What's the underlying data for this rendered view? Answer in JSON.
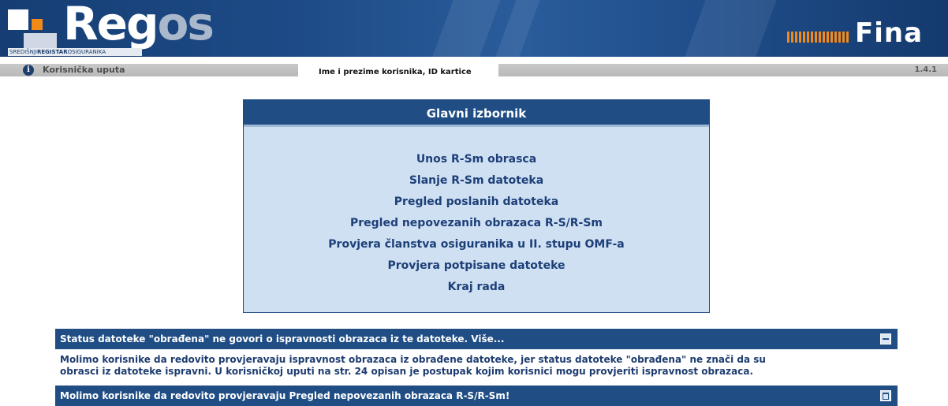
{
  "header": {
    "logo_main": "Reg",
    "logo_os": "os",
    "logo_sub_pre": "SREDIŠNJI",
    "logo_sub_bold": "REGISTAR",
    "logo_sub_post": "OSIGURANIKA",
    "fina_logo": "Fina"
  },
  "infobar": {
    "manual_link": "Korisnička uputa",
    "user": "Ime i prezime korisnika, ID kartice",
    "version": "1.4.1"
  },
  "menu": {
    "title": "Glavni izbornik",
    "items": [
      "Unos R-Sm obrasca",
      "Slanje R-Sm datoteka",
      "Pregled poslanih datoteka",
      "Pregled nepovezanih obrazaca R-S/R-Sm",
      "Provjera članstva osiguranika u II. stupu OMF-a",
      "Provjera potpisane datoteke",
      "Kraj rada"
    ]
  },
  "notices": {
    "first_title": "Status datoteke \"obrađena\" ne govori o ispravnosti obrazaca iz te datoteke. Više...",
    "first_body_line1": "Molimo korisnike da redovito provjeravaju ispravnost obrazaca iz obrađene datoteke, jer status datoteke \"obrađena\" ne znači da su",
    "first_body_line2": "obrasci iz datoteke ispravni. U korisničkoj uputi na str. 24 opisan je postupak kojim korisnici mogu provjeriti ispravnost obrazaca.",
    "second_title": "Molimo korisnike da redovito provjeravaju Pregled nepovezanih obrazaca R-S/R-Sm!"
  },
  "colors": {
    "header_blue": "#1d4a86",
    "accent_orange": "#f28a1a",
    "panel_bg": "#cfe0f2",
    "bar_blue": "#1f4d84",
    "link_blue": "#1d3f78"
  },
  "icons": {
    "info": "info-icon",
    "collapse": "minimize-icon",
    "expand": "maximize-icon"
  }
}
